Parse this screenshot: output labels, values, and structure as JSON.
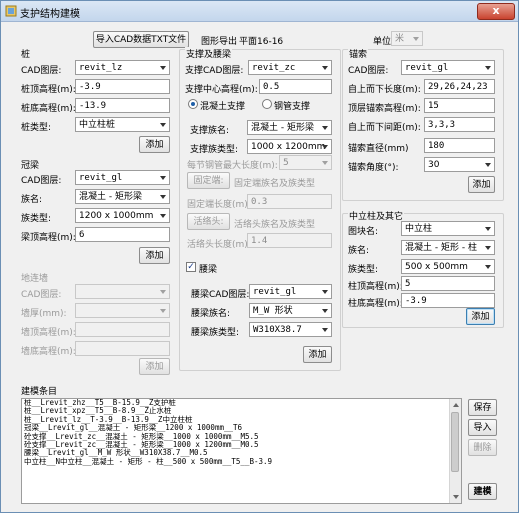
{
  "window": {
    "title": "支护结构建模",
    "close_label": "x"
  },
  "top": {
    "import_button": "导入CAD数据TXT文件",
    "graphic_export_label": "图形导出",
    "graphic_export_value": "平面16-16",
    "unit_label": "单位:",
    "unit_value": "米"
  },
  "pile": {
    "header": "桩",
    "layer_label": "CAD图层:",
    "layer_value": "revit_lz",
    "top_label": "桩顶高程(m):",
    "top_value": "-3.9",
    "bottom_label": "桩底高程(m):",
    "bottom_value": "-13.9",
    "type_label": "桩类型:",
    "type_value": "中立柱桩",
    "add_button": "添加"
  },
  "crown_beam": {
    "header": "冠梁",
    "layer_label": "CAD图层:",
    "layer_value": "revit_gl",
    "family_label": "族名:",
    "family_value": "混凝土 - 矩形梁",
    "type_label": "族类型:",
    "type_value": "1200 x 1000mm",
    "top_label": "梁顶高程(m):",
    "top_value": "6",
    "add_button": "添加"
  },
  "diaphragm": {
    "header": "地连墙",
    "layer_label": "CAD图层:",
    "layer_value": "",
    "thickness_label": "墙厚(mm):",
    "thickness_value": "",
    "top_label": "墙顶高程(m):",
    "top_value": "",
    "bottom_label": "墙底高程(m):",
    "bottom_value": "",
    "add_button": "添加"
  },
  "support": {
    "header": "支撑及腰梁",
    "layer_label": "支撑CAD图层:",
    "layer_value": "revit_zc",
    "center_label": "支撑中心高程(m):",
    "center_value": "0.5",
    "radio_concrete": "混凝土支撑",
    "radio_steel": "钢管支撑",
    "family_label": "支撑族名:",
    "family_value": "混凝土 - 矩形梁",
    "type_label": "支撑族类型:",
    "type_value": "1000 x 1200mm",
    "maxlen_label": "每节钢管最大长度(m):",
    "maxlen_value": "5",
    "fixed_btn": "固定端:",
    "fixed_desc": "固定端族名及族类型",
    "fixed_len_label": "固定端长度(m):",
    "fixed_len_value": "0.3",
    "active_btn": "活络头:",
    "active_desc": "活络头族名及族类型",
    "active_len_label": "活络头长度(m):",
    "active_len_value": "1.4",
    "waist_check_label": "腰梁",
    "waist_layer_label": "腰梁CAD图层:",
    "waist_layer_value": "revit_gl",
    "waist_family_label": "腰梁族名:",
    "waist_family_value": "M_W 形状",
    "waist_type_label": "腰梁族类型:",
    "waist_type_value": "W310X38.7",
    "add_button": "添加"
  },
  "anchor": {
    "header": "锚索",
    "layer_label": "CAD图层:",
    "layer_value": "revit_gl",
    "length_label": "自上而下长度(m):",
    "length_value": "29,26,24,23",
    "top_label": "顶层锚索高程(m):",
    "top_value": "15",
    "spacing_label": "自上而下间距(m):",
    "spacing_value": "3,3,3",
    "diameter_label": "锚索直径(mm)",
    "diameter_value": "180",
    "angle_label": "锚索角度(°):",
    "angle_value": "30",
    "add_button": "添加"
  },
  "column": {
    "header": "中立柱及其它",
    "family_label": "图块名:",
    "family_value": "中立柱",
    "name_label": "族名:",
    "name_value": "混凝土 - 矩形 - 柱",
    "type_label": "族类型:",
    "type_value": "500 x 500mm",
    "top_label": "柱顶高程(m):",
    "top_value": "5",
    "bottom_label": "柱底高程(m):",
    "bottom_value": "-3.9",
    "add_button": "添加"
  },
  "items": {
    "header": "建模条目",
    "rows": [
      "桩__Lrevit_zhz__T5__B-15.9__Z支护桩",
      "桩__Lrevit_xpz__T5__B-8.9__Z止水桩",
      "桩__Lrevit_lz__T-3.9__B-13.9__Z中立柱桩",
      "冠梁__Lrevit_gl__混凝土 - 矩形梁__1200 x 1000mm__T6",
      "砼支撑__Lrevit_zc__混凝土 - 矩形梁__1000 x 1000mm__M5.5",
      "砼支撑__Lrevit_zc__混凝土 - 矩形梁__1000 x 1200mm__M0.5",
      "腰梁__Lrevit_gl__M_W 形状__W310X38.7__M0.5",
      "中立柱__N中立柱__混凝土 - 矩形 - 柱__500 x 500mm__T5__B-3.9"
    ],
    "save_button": "保存",
    "import_button": "导入",
    "delete_button": "删除",
    "build_button": "建模"
  }
}
